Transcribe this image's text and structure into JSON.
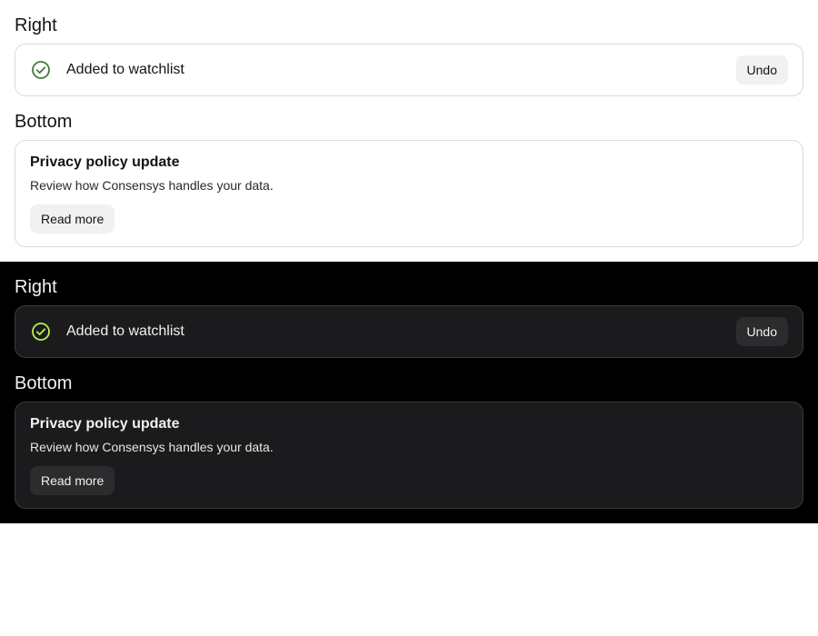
{
  "light": {
    "right_heading": "Right",
    "toast": {
      "message": "Added to watchlist",
      "action": "Undo",
      "icon": "check-circle-icon",
      "icon_color": "#457a39"
    },
    "bottom_heading": "Bottom",
    "banner": {
      "title": "Privacy policy update",
      "description": "Review how Consensys handles your data.",
      "action": "Read more"
    }
  },
  "dark": {
    "right_heading": "Right",
    "toast": {
      "message": "Added to watchlist",
      "action": "Undo",
      "icon": "check-circle-icon",
      "icon_color": "#baf24a"
    },
    "bottom_heading": "Bottom",
    "banner": {
      "title": "Privacy policy update",
      "description": "Review how Consensys handles your data.",
      "action": "Read more"
    }
  }
}
